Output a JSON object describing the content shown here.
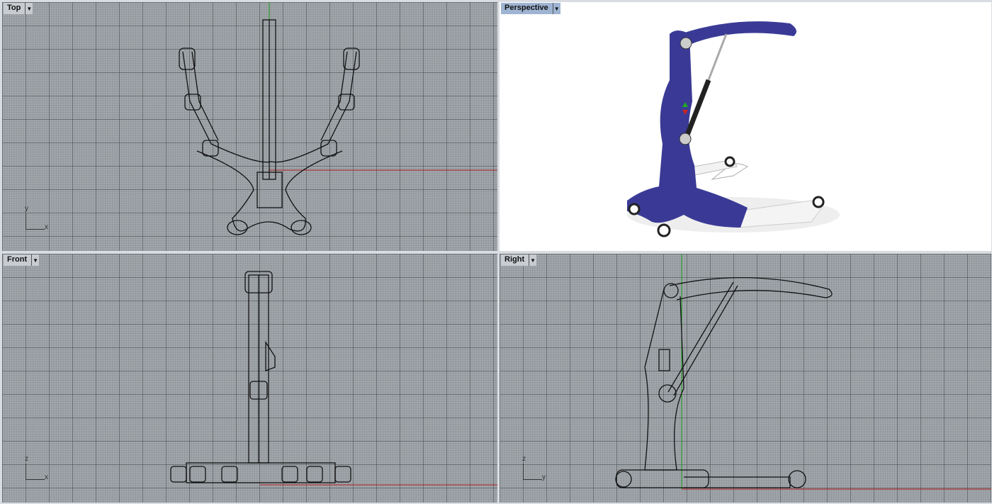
{
  "viewports": [
    {
      "name": "Top",
      "axes": [
        "y",
        "x"
      ]
    },
    {
      "name": "Perspective"
    },
    {
      "name": "Front",
      "axes": [
        "z",
        "x"
      ]
    },
    {
      "name": "Right",
      "axes": [
        "z",
        "y"
      ]
    }
  ],
  "icons": {
    "dropdown": "triangle-down"
  },
  "colors": {
    "grid_bg": "#a3a8ad",
    "x_axis": "#b22222",
    "y_axis": "#1a9a1a",
    "model_blue": "#3a3a96",
    "active_label": "#9eb4d2"
  }
}
